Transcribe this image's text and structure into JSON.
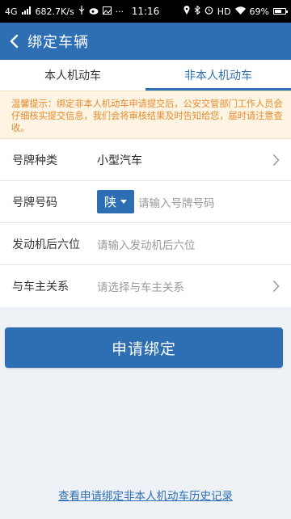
{
  "statusbar": {
    "network": "4G",
    "speed": "682.7K/s",
    "dots": "···",
    "time": "11:16",
    "hd": "HD",
    "battery": "69%",
    "battery_level": 0.69
  },
  "header": {
    "title": "绑定车辆"
  },
  "tabs": [
    {
      "label": "本人机动车",
      "active": false
    },
    {
      "label": "非本人机动车",
      "active": true
    }
  ],
  "notice": {
    "text": "温馨提示：绑定非本人机动车申请提交后，公安交管部门工作人员会仔细核实提交信息，我们会将审核结果及时告知给您，届时请注意查收。"
  },
  "form": {
    "plate_type": {
      "label": "号牌种类",
      "value": "小型汽车"
    },
    "plate_number": {
      "label": "号牌号码",
      "province": "陕",
      "placeholder": "请输入号牌号码"
    },
    "engine": {
      "label": "发动机后六位",
      "placeholder": "请输入发动机后六位"
    },
    "relation": {
      "label": "与车主关系",
      "placeholder": "请选择与车主关系"
    }
  },
  "submit_label": "申请绑定",
  "history_link": "查看申请绑定非本人机动车历史记录",
  "colors": {
    "primary": "#2e6fb4",
    "notice_text": "#e78a2c",
    "notice_bg": "#fdf4e4"
  }
}
